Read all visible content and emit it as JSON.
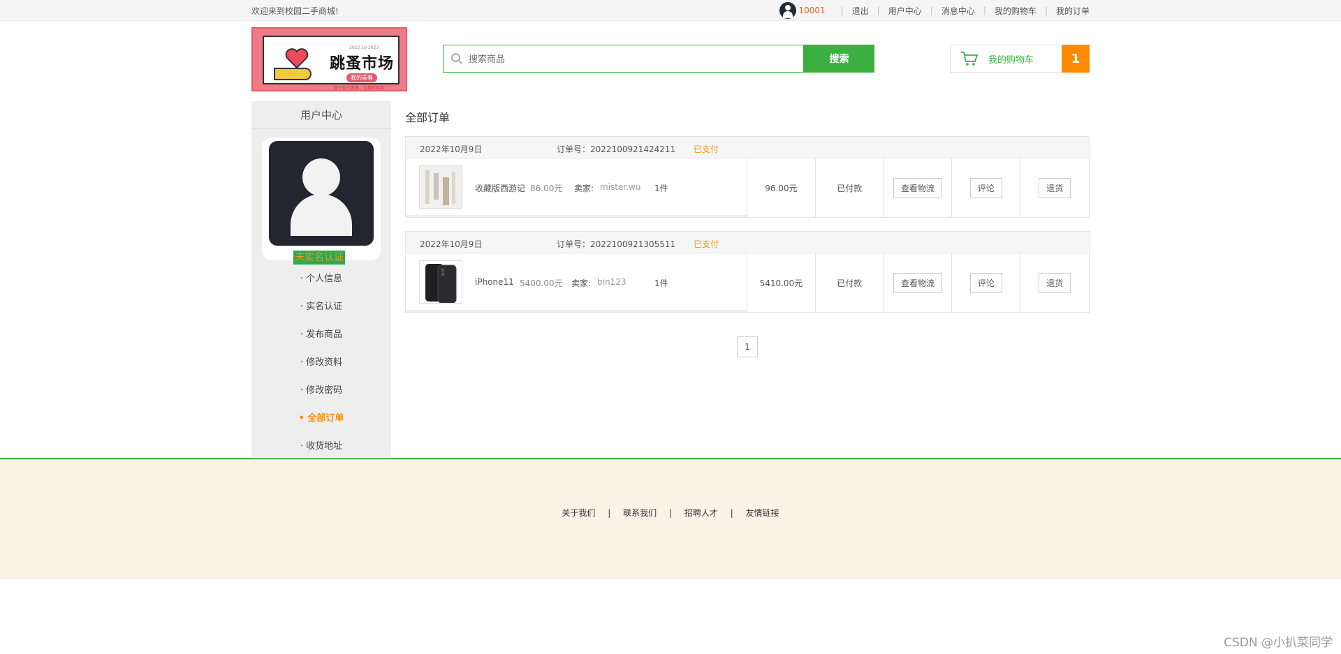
{
  "topbar": {
    "welcome": "欢迎来到校园二手商城!",
    "user_id": "10001",
    "links": [
      "退出",
      "用户中心",
      "消息中心",
      "我的购物车",
      "我的订单"
    ]
  },
  "header": {
    "logo": {
      "title": "跳蚤市场",
      "tag": "我的青春",
      "small_top": "2022.10-2023",
      "small_bottom": "留下你的青春，让精彩继续"
    },
    "search": {
      "placeholder": "搜索商品",
      "button": "搜索"
    },
    "cart": {
      "label": "我的购物车",
      "count": "1"
    }
  },
  "sidebar": {
    "title": "用户中心",
    "badge": "未实名认证",
    "items": [
      "· 个人信息",
      "· 实名认证",
      "· 发布商品",
      "· 修改资料",
      "· 修改密码",
      "• 全部订单",
      "· 收货地址"
    ],
    "active_index": 5
  },
  "main": {
    "title": "全部订单",
    "orders": [
      {
        "date": "2022年10月9日",
        "order_no_label": "订单号：",
        "order_no": "2022100921424211",
        "status": "已支付",
        "item_name": "收藏版西游记",
        "item_price": "86.00元",
        "seller_label": "卖家:",
        "seller": "mister.wu",
        "qty": "1件",
        "total": "96.00元",
        "pay_state": "已付款",
        "actions": [
          "查看物流",
          "评论",
          "退货"
        ]
      },
      {
        "date": "2022年10月9日",
        "order_no_label": "订单号：",
        "order_no": "2022100921305511",
        "status": "已支付",
        "item_name": "iPhone11",
        "item_price": "5400.00元",
        "seller_label": "卖家:",
        "seller": "bin123",
        "qty": "1件",
        "total": "5410.00元",
        "pay_state": "已付款",
        "actions": [
          "查看物流",
          "评论",
          "退货"
        ]
      }
    ],
    "page": "1"
  },
  "footer": {
    "links": [
      "关于我们",
      "联系我们",
      "招聘人才",
      "友情链接"
    ]
  },
  "watermark": "CSDN @小扒菜同学",
  "colors": {
    "green": "#3bb041",
    "orange": "#ff8a00",
    "status": "#e89a10"
  }
}
